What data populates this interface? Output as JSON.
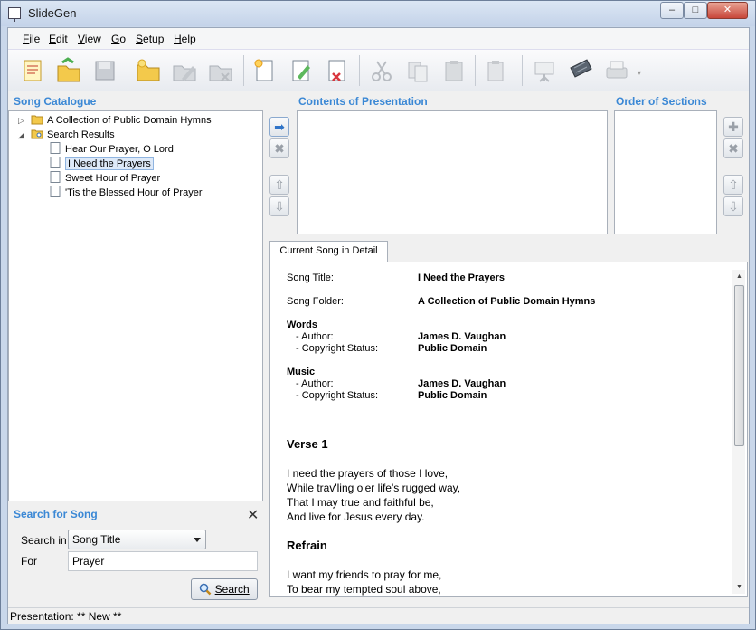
{
  "window": {
    "title": "SlideGen",
    "minimize": "–",
    "maximize": "□",
    "close": "✕"
  },
  "menu": [
    {
      "label": "File",
      "accel": "F",
      "rest": "ile"
    },
    {
      "label": "Edit",
      "accel": "E",
      "rest": "dit"
    },
    {
      "label": "View",
      "accel": "V",
      "rest": "iew"
    },
    {
      "label": "Go",
      "accel": "G",
      "rest": "o"
    },
    {
      "label": "Setup",
      "accel": "S",
      "rest": "etup"
    },
    {
      "label": "Help",
      "accel": "H",
      "rest": "elp"
    }
  ],
  "toolbar_icons": [
    "new-catalogue-icon",
    "open-catalogue-icon",
    "save-catalogue-icon",
    "new-folder-icon",
    "rename-folder-icon",
    "delete-folder-icon",
    "new-song-icon",
    "edit-song-icon",
    "delete-song-icon",
    "cut-icon",
    "copy-icon",
    "paste-icon",
    "clipboard-icon",
    "presentation-icon",
    "filmstrip-icon",
    "print-icon"
  ],
  "catalogue": {
    "heading": "Song Catalogue",
    "root1": "A Collection of Public Domain Hymns",
    "root2": "Search Results",
    "children": [
      "Hear Our Prayer, O Lord",
      "I Need the Prayers",
      "Sweet Hour of Prayer",
      "'Tis the Blessed Hour of Prayer"
    ],
    "selected_index": 1
  },
  "contents": {
    "heading": "Contents of Presentation"
  },
  "order": {
    "heading": "Order of Sections"
  },
  "detail": {
    "tab": "Current Song in Detail",
    "song_title_label": "Song Title:",
    "song_title": "I Need the Prayers",
    "song_folder_label": "Song Folder:",
    "song_folder": "A Collection of Public Domain Hymns",
    "words_heading": "Words",
    "words_author_label": "- Author:",
    "words_author": "James D. Vaughan",
    "words_copyright_label": "- Copyright Status:",
    "words_copyright": "Public Domain",
    "music_heading": "Music",
    "music_author_label": "- Author:",
    "music_author": "James D. Vaughan",
    "music_copyright_label": "- Copyright Status:",
    "music_copyright": "Public Domain",
    "verse_heading": "Verse 1",
    "verse_lines": [
      "I need the prayers of those I love,",
      "While trav'ling o'er life's rugged way,",
      "That I may true and faithful be,",
      "And live for Jesus every day."
    ],
    "refrain_heading": "Refrain",
    "refrain_lines": [
      "I want my friends to pray for me,",
      "To bear my tempted soul above,"
    ]
  },
  "search": {
    "heading": "Search for Song",
    "close": "✕",
    "search_in_label": "Search in",
    "search_in_value": "Song Title",
    "for_label": "For",
    "for_value": "Prayer",
    "button": "Search"
  },
  "status": "Presentation: ** New **"
}
